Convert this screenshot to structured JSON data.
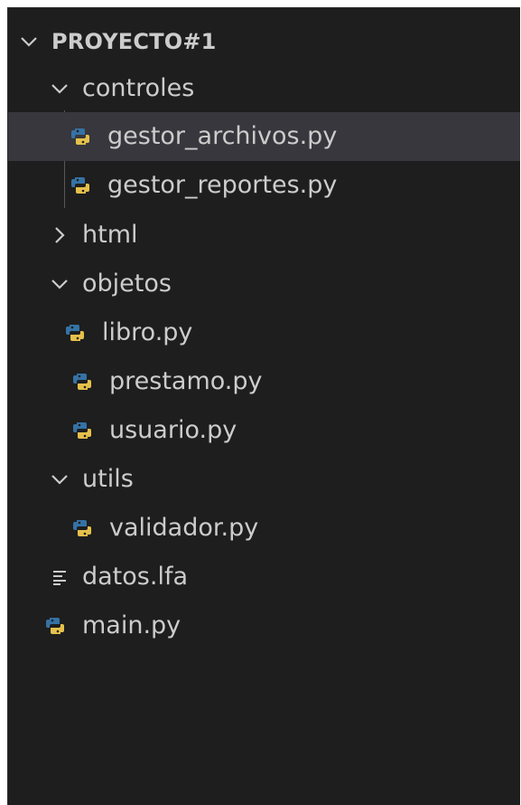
{
  "explorer": {
    "project_title": "PROYECTO#1",
    "items": [
      {
        "label": "controles",
        "kind": "folder",
        "expanded": true
      },
      {
        "label": "gestor_archivos.py",
        "kind": "python",
        "selected": true
      },
      {
        "label": "gestor_reportes.py",
        "kind": "python"
      },
      {
        "label": "html",
        "kind": "folder",
        "expanded": false
      },
      {
        "label": "objetos",
        "kind": "folder",
        "expanded": true
      },
      {
        "label": "libro.py",
        "kind": "python"
      },
      {
        "label": "prestamo.py",
        "kind": "python"
      },
      {
        "label": "usuario.py",
        "kind": "python"
      },
      {
        "label": "utils",
        "kind": "folder",
        "expanded": true
      },
      {
        "label": "validador.py",
        "kind": "python"
      },
      {
        "label": "datos.lfa",
        "kind": "text"
      },
      {
        "label": "main.py",
        "kind": "python"
      }
    ]
  },
  "colors": {
    "background": "#1e1e1e",
    "selected_row": "#37373d",
    "text": "#cccccc",
    "python_blue": "#3572a5",
    "python_yellow": "#e5c04b",
    "guide_line": "#585858"
  },
  "icons": {
    "chevron_open": "chevron-down-icon",
    "chevron_closed": "chevron-right-icon",
    "python_file": "python-file-icon",
    "text_file": "text-file-icon"
  }
}
